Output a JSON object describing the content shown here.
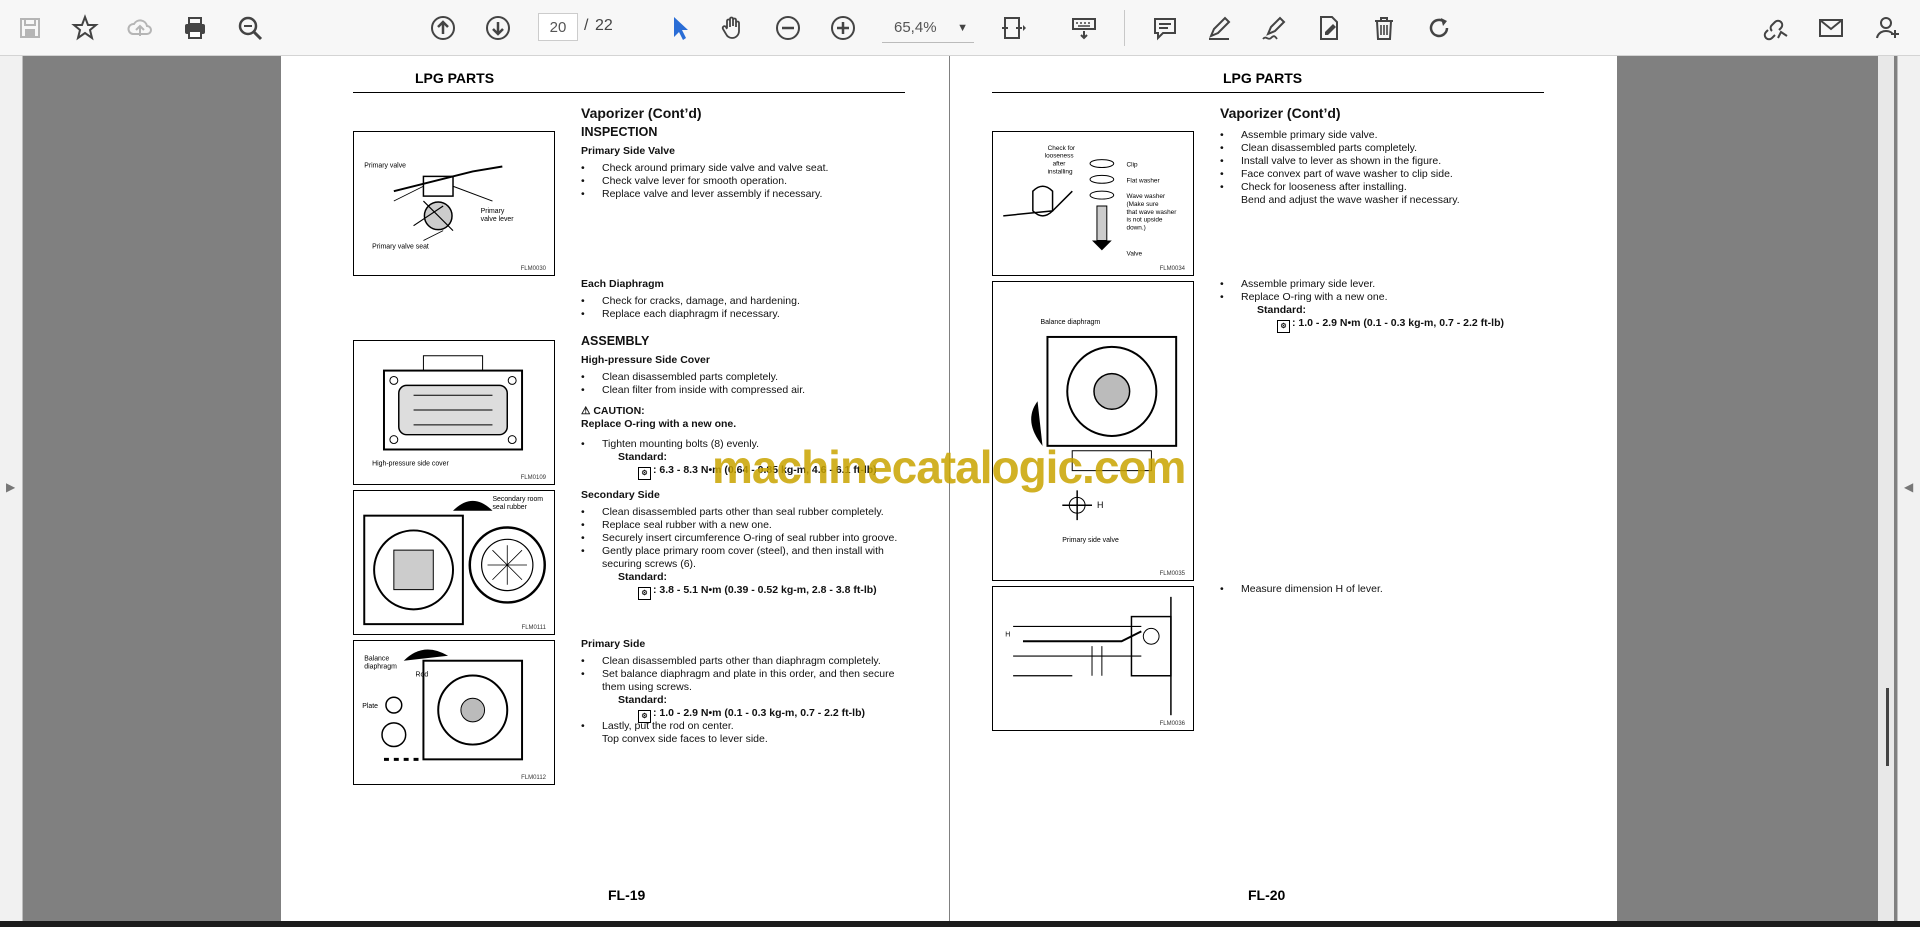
{
  "toolbar": {
    "page_current": "20",
    "page_separator": "/",
    "page_total": "22",
    "zoom": "65,4%"
  },
  "watermark": "machinecatalogic.com",
  "left_page": {
    "header": "LPG PARTS",
    "title": "Vaporizer (Cont’d)",
    "inspection": "INSPECTION",
    "primary_side_valve": "Primary Side Valve",
    "psv_items": [
      "Check around primary side valve and valve seat.",
      "Check valve lever for smooth operation.",
      "Replace valve and lever assembly if necessary."
    ],
    "each_diaphragm": "Each Diaphragm",
    "ed_items": [
      "Check for cracks, damage, and hardening.",
      "Replace each diaphragm if necessary."
    ],
    "assembly": "ASSEMBLY",
    "hp_cover": "High-pressure Side Cover",
    "hp_items": [
      "Clean disassembled parts completely.",
      "Clean filter from inside with compressed air."
    ],
    "caution": "CAUTION:",
    "caution_text": "Replace O-ring with a new one.",
    "tighten": "Tighten mounting bolts (8) evenly.",
    "standard": "Standard:",
    "torque1": ": 6.3 - 8.3 N•m (0.64 - 0.85 kg-m, 4.6 - 6.1 ft-lb)",
    "secondary_side": "Secondary Side",
    "ss_items": [
      "Clean disassembled parts other than seal rubber completely.",
      "Replace seal rubber with a new one.",
      "Securely insert circumference O-ring of seal rubber into groove.",
      "Gently place primary room cover (steel), and then install with"
    ],
    "ss_cont": "securing screws (6).",
    "torque2": ": 3.8 - 5.1 N•m (0.39 - 0.52 kg-m, 2.8 - 3.8 ft-lb)",
    "primary_side": "Primary Side",
    "ps_items": [
      "Clean disassembled parts other than diaphragm completely.",
      "Set balance diaphragm and plate in this order, and then secure"
    ],
    "ps_cont": "them using screws.",
    "torque3": ": 1.0 - 2.9 N•m (0.1 - 0.3 kg-m, 0.7 - 2.2 ft-lb)",
    "lastly": "Lastly, put the rod on center.",
    "lastly_cont": "Top convex side faces to lever side.",
    "footer": "FL-19",
    "fig1": {
      "id": "FLM0030",
      "l1": "Primary valve",
      "l2": "Primary",
      "l3": "valve lever",
      "l4": "Primary valve seat"
    },
    "fig2": {
      "id": "FLM0109",
      "l1": "High-pressure side cover"
    },
    "fig3": {
      "id": "FLM0111",
      "l1": "Secondary room",
      "l2": "seal rubber"
    },
    "fig4": {
      "id": "FLM0112",
      "l1": "Balance",
      "l2": "diaphragm",
      "l3": "Rod",
      "l4": "Plate"
    }
  },
  "right_page": {
    "header": "LPG PARTS",
    "title": "Vaporizer (Cont’d)",
    "items1": [
      "Assemble primary side valve.",
      "Clean disassembled parts completely.",
      "Install valve to lever as shown in the figure.",
      "Face convex part of wave washer to clip side.",
      "Check for looseness after installing."
    ],
    "items1_cont": "Bend and adjust the wave washer if necessary.",
    "items2": [
      "Assemble primary side lever.",
      "Replace O-ring with a new one."
    ],
    "standard": "Standard:",
    "torque": ": 1.0 - 2.9 N•m (0.1 - 0.3 kg-m, 0.7 - 2.2 ft-lb)",
    "measure": "Measure dimension H of lever.",
    "footer": "FL-20",
    "fig1": {
      "id": "FLM0034",
      "l1": "Check for",
      "l2": "looseness",
      "l3": "after",
      "l4": "installing",
      "l5": "Clip",
      "l6": "Flat washer",
      "l7": "Wave washer",
      "l8": "(Make sure",
      "l9": "that wave washer",
      "l10": "is not upside",
      "l11": "down.)",
      "l12": "Valve"
    },
    "fig2": {
      "id": "FLM0035",
      "l1": "Balance diaphragm",
      "l2": "H",
      "l3": "Primary side valve"
    },
    "fig3": {
      "id": "FLM0036",
      "l1": "H"
    }
  }
}
